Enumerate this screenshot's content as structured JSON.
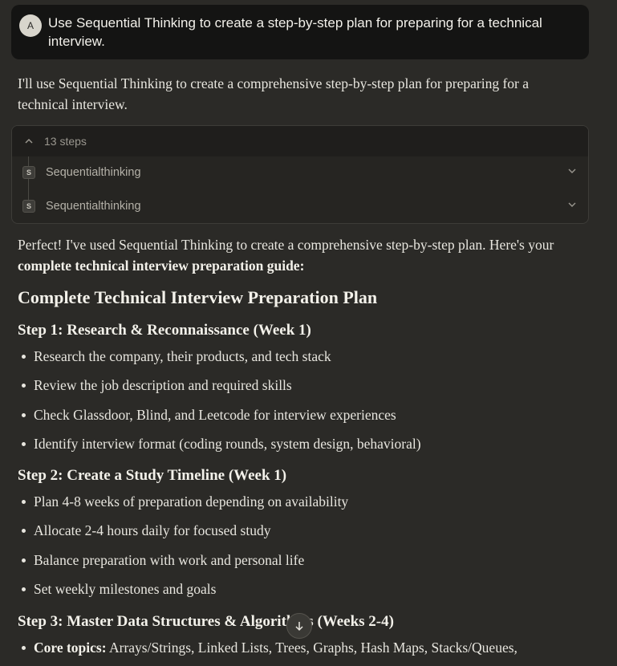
{
  "user_message": {
    "avatar_initial": "A",
    "text": "Use Sequential Thinking to create a step-by-step plan for preparing for a technical interview."
  },
  "intro": "I'll use Sequential Thinking to create a comprehensive step-by-step plan for preparing for a technical interview.",
  "tool_panel": {
    "steps_label": "13 steps",
    "rows": [
      {
        "icon_letter": "S",
        "name": "Sequentialthinking"
      },
      {
        "icon_letter": "S",
        "name": "Sequentialthinking"
      }
    ]
  },
  "summary": {
    "prefix": "Perfect! I've used Sequential Thinking to create a comprehensive step-by-step plan. Here's your ",
    "bold": "complete technical interview preparation guide:"
  },
  "plan_title": "Complete Technical Interview Preparation Plan",
  "steps": [
    {
      "heading": "Step 1: Research & Reconnaissance (Week 1)",
      "items": [
        "Research the company, their products, and tech stack",
        "Review the job description and required skills",
        "Check Glassdoor, Blind, and Leetcode for interview experiences",
        "Identify interview format (coding rounds, system design, behavioral)"
      ]
    },
    {
      "heading": "Step 2: Create a Study Timeline (Week 1)",
      "items": [
        "Plan 4-8 weeks of preparation depending on availability",
        "Allocate 2-4 hours daily for focused study",
        "Balance preparation with work and personal life",
        "Set weekly milestones and goals"
      ]
    },
    {
      "heading": "Step 3: Master Data Structures & Algorithms (Weeks 2-4)",
      "items": [
        {
          "bold": "Core topics:",
          "text": " Arrays/Strings, Linked Lists, Trees, Graphs, Hash Maps, Stacks/Queues,"
        }
      ]
    }
  ],
  "icons": {
    "collapse": "chevron-up-icon",
    "expand": "chevron-down-icon",
    "scroll": "arrow-down-icon"
  }
}
